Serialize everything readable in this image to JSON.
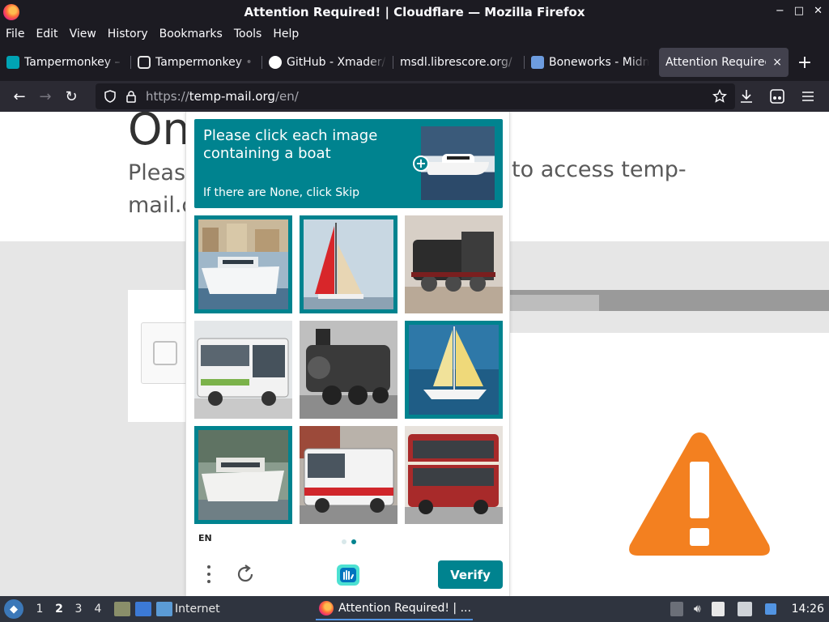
{
  "window": {
    "title": "Attention Required! | Cloudflare — Mozilla Firefox",
    "controls": [
      "−",
      "□",
      "✕"
    ]
  },
  "menu": [
    "File",
    "Edit",
    "View",
    "History",
    "Bookmarks",
    "Tools",
    "Help"
  ],
  "tabs": [
    {
      "title": "Tampermonkey – ",
      "icon": "tampermonkey-icon",
      "color": "#00a3b4"
    },
    {
      "title": "Tampermonkey • ",
      "icon": "tampermonkey-dark-icon",
      "color": "#e6e6e6"
    },
    {
      "title": "GitHub - Xmader/",
      "icon": "github-icon",
      "color": "#ffffff"
    },
    {
      "title": "msdl.librescore.org/",
      "icon": "",
      "color": ""
    },
    {
      "title": "Boneworks - Midn",
      "icon": "musescore-icon",
      "color": "#6d9cdf"
    },
    {
      "title": "Attention Required!",
      "icon": "",
      "color": "",
      "active": true,
      "close": "×"
    }
  ],
  "new_tab": "+",
  "nav": {
    "back": "←",
    "forward": "→",
    "reload": "↻",
    "url_scheme": "https://",
    "url_host": "temp-mail.org",
    "url_path": "/en/"
  },
  "page": {
    "heading_partial": "On",
    "sub_left_1": "Pleas",
    "sub_left_2": "mail.c",
    "sub_right": "to access temp-"
  },
  "captcha": {
    "prompt": "Please click each image containing a boat",
    "hint": "If there are None, click Skip",
    "plus": "+",
    "language": "EN",
    "verify_label": "Verify",
    "colors": {
      "accent": "#00838f"
    },
    "tiles": [
      {
        "subject": "motor yacht at harbour",
        "selected": true
      },
      {
        "subject": "red sailboat",
        "selected": true
      },
      {
        "subject": "steam locomotive",
        "selected": false
      },
      {
        "subject": "white bus",
        "selected": false
      },
      {
        "subject": "steam locomotive",
        "selected": false
      },
      {
        "subject": "yellow sailboat",
        "selected": true
      },
      {
        "subject": "motor yacht",
        "selected": true
      },
      {
        "subject": "city bus",
        "selected": false
      },
      {
        "subject": "double-decker bus",
        "selected": false
      }
    ],
    "page_dots": 2,
    "active_dot": 1
  },
  "taskbar": {
    "workspaces": [
      "1",
      "2",
      "3",
      "4"
    ],
    "current_workspace": "2",
    "launcher_label": "Internet",
    "active_task": "Attention Required! | ...",
    "clock": "14:26"
  }
}
